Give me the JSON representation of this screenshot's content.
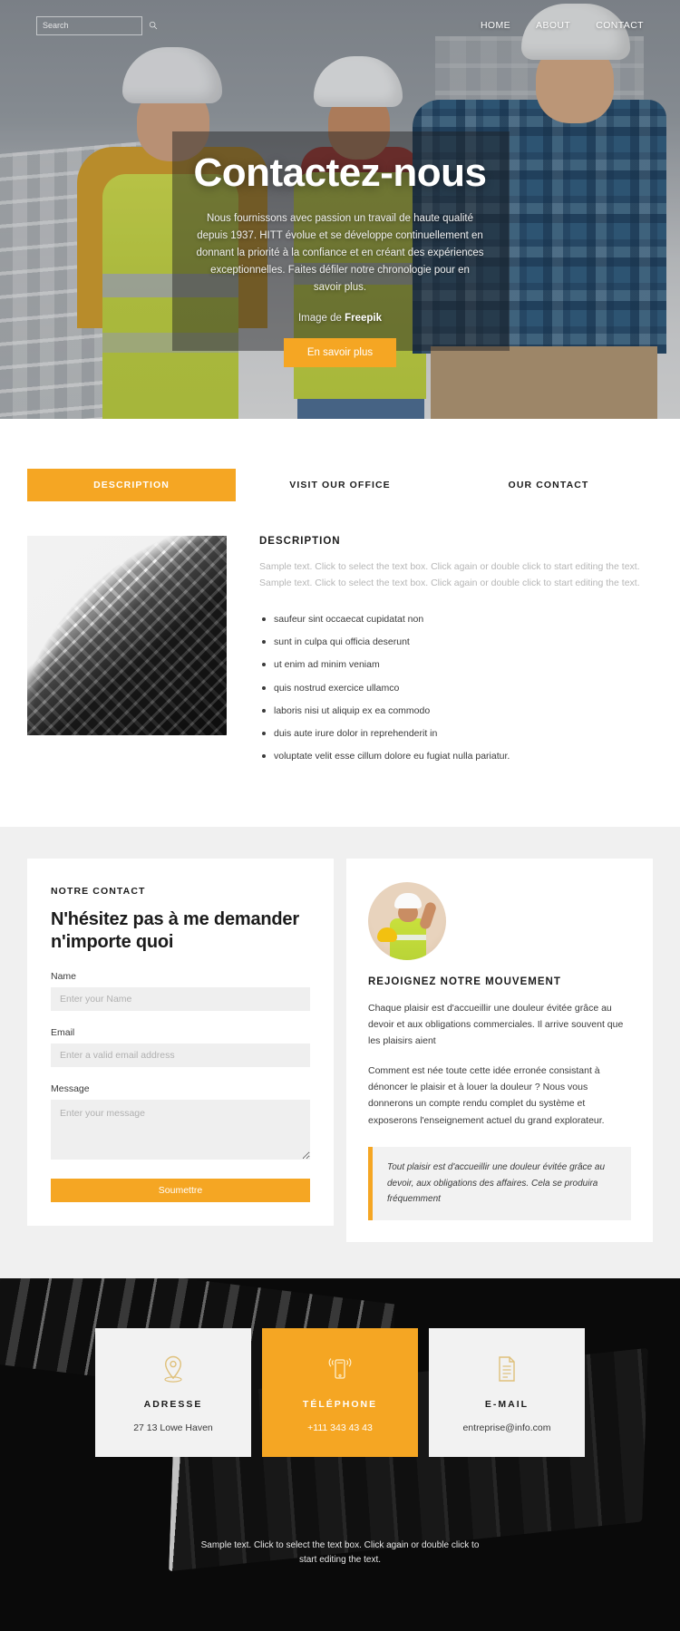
{
  "colors": {
    "accent": "#f5a623",
    "dark": "#090909",
    "muted_text": "#b6b6b6",
    "section_bg": "#f0f0f0"
  },
  "header": {
    "search": {
      "placeholder": "Search",
      "value": "",
      "icon": "search-icon"
    },
    "nav": [
      {
        "label": "HOME"
      },
      {
        "label": "ABOUT"
      },
      {
        "label": "CONTACT"
      }
    ]
  },
  "hero": {
    "title": "Contactez-nous",
    "subtitle": "Nous fournissons avec passion un travail de haute qualité depuis 1937. HITT évolue et se développe continuellement en donnant la priorité à la confiance et en créant des expériences exceptionnelles. Faites défiler notre chronologie pour en savoir plus.",
    "credit_prefix": "Image de ",
    "credit_source": "Freepik",
    "cta_label": "En savoir plus"
  },
  "tabs": [
    {
      "label": "DESCRIPTION",
      "active": true
    },
    {
      "label": "VISIT OUR OFFICE",
      "active": false
    },
    {
      "label": "OUR CONTACT",
      "active": false
    }
  ],
  "description": {
    "heading": "DESCRIPTION",
    "paragraph": "Sample text. Click to select the text box. Click again or double click to start editing the text. Sample text. Click to select the text box. Click again or double click to start editing the text.",
    "bullets": [
      "saufeur sint occaecat cupidatat non",
      "sunt in culpa qui officia deserunt",
      "ut enim ad minim veniam",
      "quis nostrud exercice ullamco",
      "laboris nisi ut aliquip ex ea commodo",
      "duis aute irure dolor in reprehenderit in",
      "voluptate velit esse cillum dolore eu fugiat nulla pariatur."
    ]
  },
  "contact_form": {
    "eyebrow": "NOTRE CONTACT",
    "title": "N'hésitez pas à me demander n'importe quoi",
    "name_label": "Name",
    "name_placeholder": "Enter your Name",
    "name_value": "",
    "email_label": "Email",
    "email_placeholder": "Enter a valid email address",
    "email_value": "",
    "message_label": "Message",
    "message_placeholder": "Enter your message",
    "message_value": "",
    "submit_label": "Soumettre"
  },
  "movement": {
    "avatar": "worker-avatar",
    "heading": "REJOIGNEZ NOTRE MOUVEMENT",
    "paragraph1": "Chaque plaisir est d'accueillir une douleur évitée grâce au devoir et aux obligations commerciales. Il arrive souvent que les plaisirs aient",
    "paragraph2": "Comment est née toute cette idée erronée consistant à dénoncer le plaisir et à louer la douleur ? Nous vous donnerons un compte rendu complet du système et exposerons l'enseignement actuel du grand explorateur.",
    "quote": "Tout plaisir est d'accueillir une douleur évitée grâce au devoir, aux obligations des affaires. Cela se produira fréquemment"
  },
  "info_cards": [
    {
      "icon": "map-pin-icon",
      "title": "ADRESSE",
      "value": "27 13 Lowe Haven",
      "accent": false
    },
    {
      "icon": "mobile-phone-icon",
      "title": "TÉLÉPHONE",
      "value": "+111 343 43 43",
      "accent": true
    },
    {
      "icon": "document-icon",
      "title": "E-MAIL",
      "value": "entreprise@info.com",
      "accent": false
    }
  ],
  "footer": {
    "text": "Sample text. Click to select the text box. Click again or double click to start editing the text."
  }
}
